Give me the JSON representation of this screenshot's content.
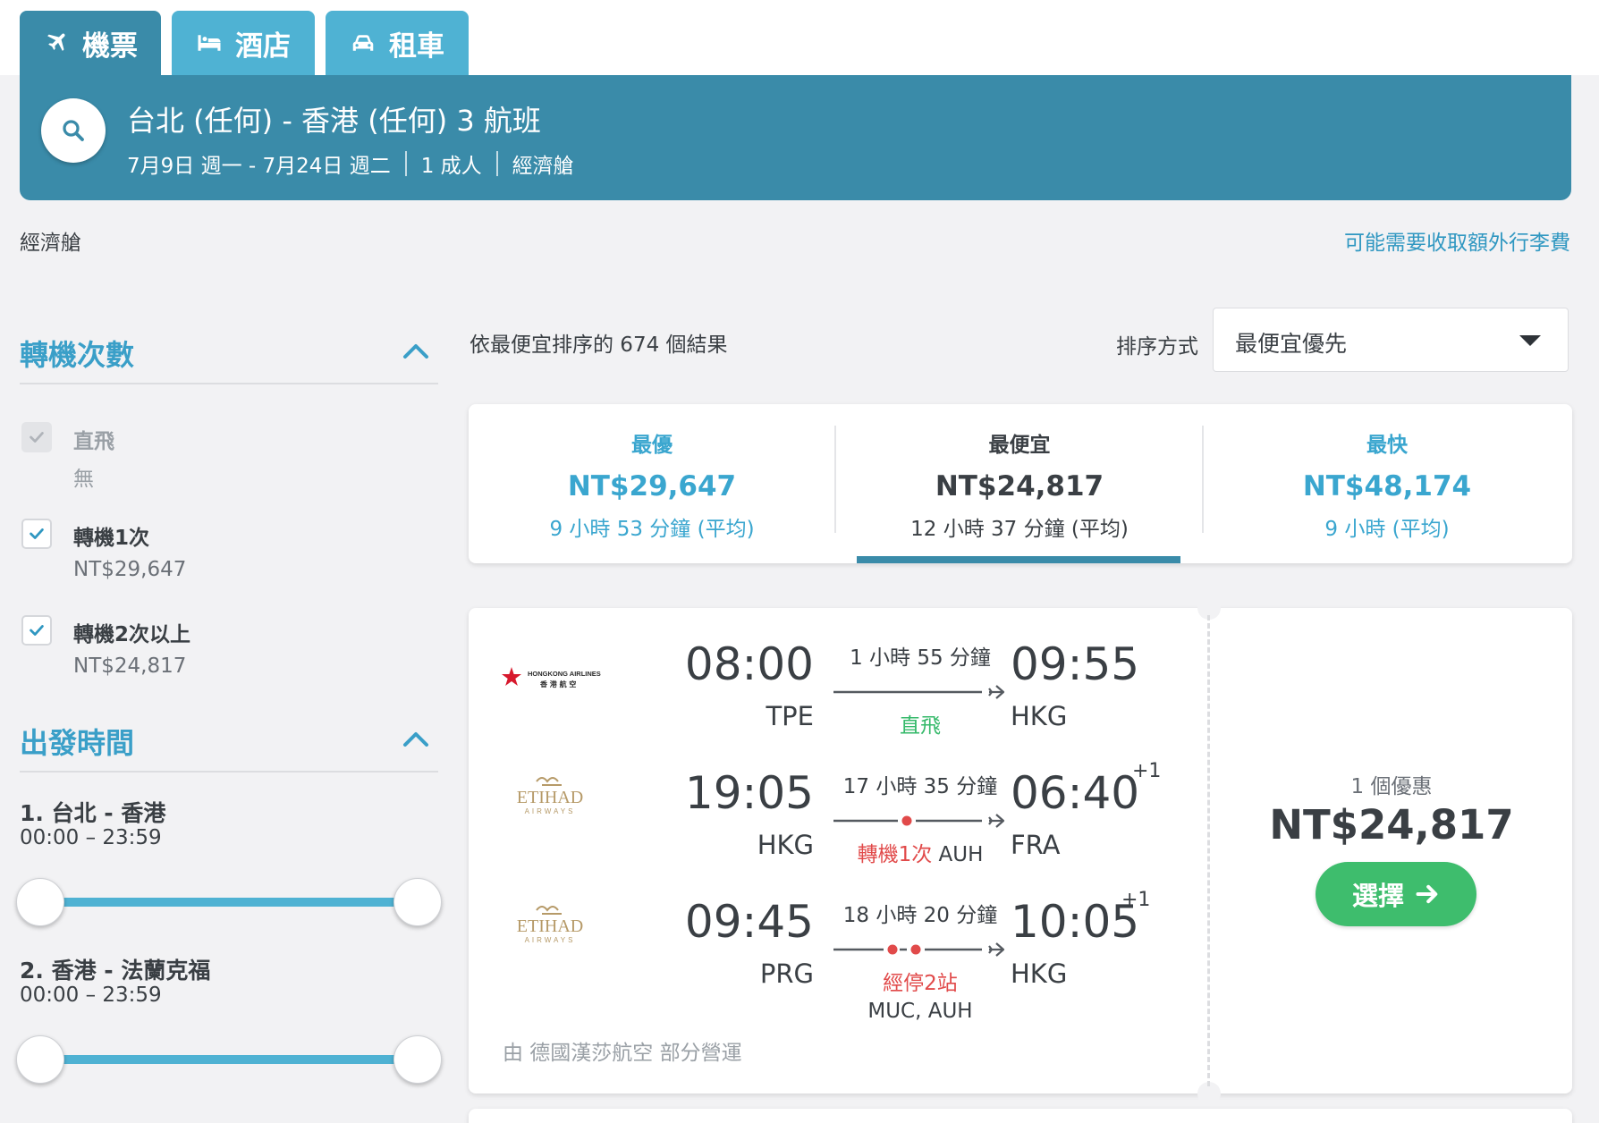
{
  "tabs": [
    {
      "label": "機票",
      "icon": "plane-icon",
      "active": true
    },
    {
      "label": "酒店",
      "icon": "bed-icon",
      "active": false
    },
    {
      "label": "租車",
      "icon": "car-icon",
      "active": false
    }
  ],
  "search": {
    "title": "台北 (任何) - 香港 (任何) 3 航班",
    "dates": "7月9日 週一 - 7月24日 週二",
    "travelers": "1 成人",
    "cabin": "經濟艙"
  },
  "cabin_line": {
    "left": "經濟艙",
    "right": "可能需要收取額外行李費"
  },
  "filters": {
    "stops": {
      "title": "轉機次數",
      "items": [
        {
          "label": "直飛",
          "price": "無",
          "checked": true,
          "disabled": true
        },
        {
          "label": "轉機1次",
          "price": "NT$29,647",
          "checked": true,
          "disabled": false
        },
        {
          "label": "轉機2次以上",
          "price": "NT$24,817",
          "checked": true,
          "disabled": false
        }
      ]
    },
    "departure": {
      "title": "出發時間",
      "legs": [
        {
          "route": "1. 台北 - 香港",
          "range": "00:00 – 23:59"
        },
        {
          "route": "2. 香港 - 法蘭克福",
          "range": "00:00 – 23:59"
        }
      ]
    }
  },
  "results": {
    "count_text": "依最便宜排序的 674 個結果",
    "sort_label": "排序方式",
    "sort_value": "最便宜優先"
  },
  "sort_tabs": [
    {
      "title": "最優",
      "price": "NT$29,647",
      "duration": "9 小時 53 分鐘 (平均)"
    },
    {
      "title": "最便宜",
      "price": "NT$24,817",
      "duration": "12 小時 37 分鐘 (平均)",
      "selected": true
    },
    {
      "title": "最快",
      "price": "NT$48,174",
      "duration": "9 小時 (平均)"
    }
  ],
  "flight": {
    "legs": [
      {
        "airline": "HONGKONG AIRLINES",
        "airline_local": "香 港 航 空",
        "dep_time": "08:00",
        "dep_code": "TPE",
        "duration": "1 小時 55 分鐘",
        "stops_text": "直飛",
        "stops_type": "direct",
        "stops_via": "",
        "arr_time": "09:55",
        "arr_code": "HKG",
        "plus_day": ""
      },
      {
        "airline": "ETIHAD",
        "airline_sub": "AIRWAYS",
        "dep_time": "19:05",
        "dep_code": "HKG",
        "duration": "17 小時 35 分鐘",
        "stops_text": "轉機1次",
        "stops_type": "one",
        "stops_via": "AUH",
        "arr_time": "06:40",
        "arr_code": "FRA",
        "plus_day": "+1"
      },
      {
        "airline": "ETIHAD",
        "airline_sub": "AIRWAYS",
        "dep_time": "09:45",
        "dep_code": "PRG",
        "duration": "18 小時 20 分鐘",
        "stops_text": "經停2站",
        "stops_type": "two",
        "stops_via": "MUC, AUH",
        "arr_time": "10:05",
        "arr_code": "HKG",
        "plus_day": "+1"
      }
    ],
    "operated_by": "由 德國漢莎航空 部分營運",
    "deal_count": "1 個優惠",
    "price": "NT$24,817",
    "select_label": "選擇"
  },
  "colors": {
    "tab_active": "#3a8ba9",
    "tab_inactive": "#4fb2d3",
    "accent_blue": "#3aa6cf",
    "select_green": "#3ebd6d",
    "direct_green": "#35b96a",
    "stop_red": "#e14a4a",
    "etihad_gold": "#b69a68",
    "hka_red": "#d7192d"
  }
}
